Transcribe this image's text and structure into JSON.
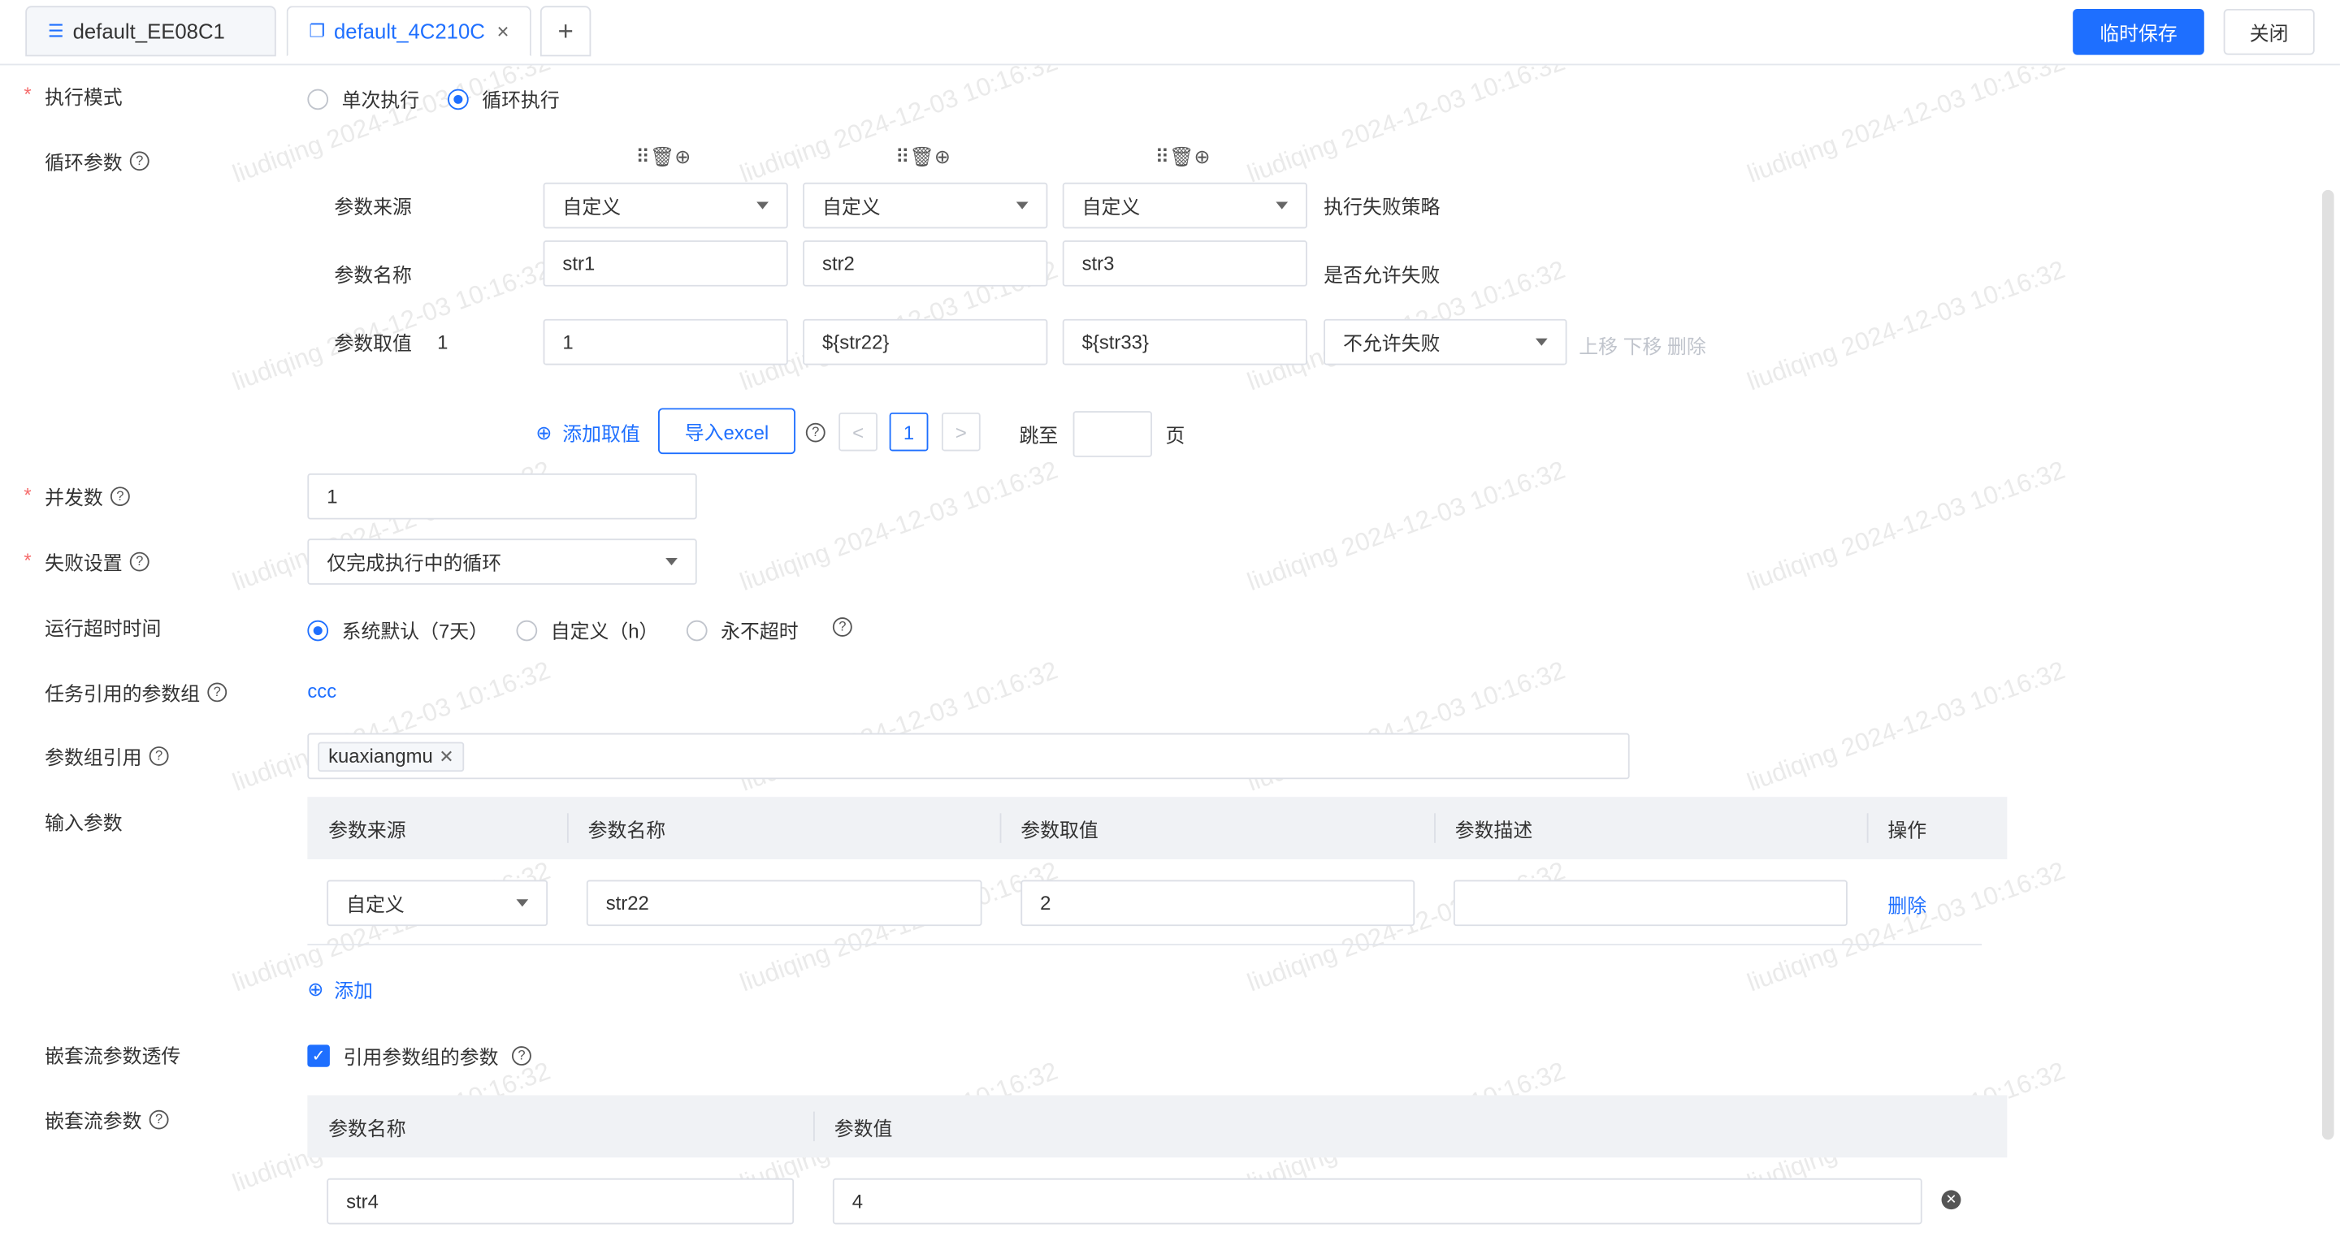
{
  "tabs": [
    {
      "label": "default_EE08C1",
      "icon": "database-icon"
    },
    {
      "label": "default_4C210C",
      "icon": "copy-icon",
      "close": "×"
    }
  ],
  "add_tab_symbol": "+",
  "header_buttons": {
    "save": "临时保存",
    "close": "关闭"
  },
  "form": {
    "exec_mode": {
      "label": "执行模式",
      "required": "*",
      "options": [
        "单次执行",
        "循环执行"
      ],
      "selected": "循环执行"
    },
    "loop_params": {
      "label": "循环参数",
      "help": "?",
      "row_labels": {
        "source": "参数来源",
        "name": "参数名称",
        "value": "参数取值",
        "value_index": "1"
      },
      "columns": [
        {
          "source": "自定义",
          "name": "str1",
          "value": "1"
        },
        {
          "source": "自定义",
          "name": "str2",
          "value": "${str22}"
        },
        {
          "source": "自定义",
          "name": "str3",
          "value": "${str33}"
        }
      ],
      "fail_policy_label": "执行失败策略",
      "allow_fail_label": "是否允许失败",
      "allow_fail_value": "不允许失败",
      "row_actions": "上移 下移 删除",
      "add_value": "添加取值",
      "import_excel": "导入excel",
      "pager": {
        "prev": "<",
        "current": "1",
        "next": ">",
        "jump_label": "跳至",
        "page_label": "页",
        "jump_value": ""
      }
    },
    "concurrency": {
      "label": "并发数",
      "required": "*",
      "value": "1"
    },
    "fail_setting": {
      "label": "失败设置",
      "required": "*",
      "value": "仅完成执行中的循环"
    },
    "timeout": {
      "label": "运行超时时间",
      "options": [
        "系统默认（7天）",
        "自定义（h）",
        "永不超时"
      ],
      "selected": "系统默认（7天）"
    },
    "task_param_group": {
      "label": "任务引用的参数组",
      "value": "ccc"
    },
    "param_group_ref": {
      "label": "参数组引用",
      "tags": [
        "kuaxiangmu"
      ]
    },
    "input_params": {
      "label": "输入参数",
      "headers": [
        "参数来源",
        "参数名称",
        "参数取值",
        "参数描述",
        "操作"
      ],
      "rows": [
        {
          "source": "自定义",
          "name": "str22",
          "value": "2",
          "desc": "",
          "action": "删除"
        }
      ],
      "add": "添加"
    },
    "nested_pass": {
      "label": "嵌套流参数透传",
      "checkbox_label": "引用参数组的参数",
      "checked": true
    },
    "nested_params": {
      "label": "嵌套流参数",
      "headers": [
        "参数名称",
        "参数值"
      ],
      "rows": [
        {
          "name": "str4",
          "value": "4"
        }
      ]
    }
  },
  "watermark": "liudiqing 2024-12-03 10:16:32",
  "colors": {
    "primary": "#1e6fff",
    "required": "#f56c6c",
    "border": "#dcdfe6",
    "header_bg": "#f0f2f5"
  }
}
